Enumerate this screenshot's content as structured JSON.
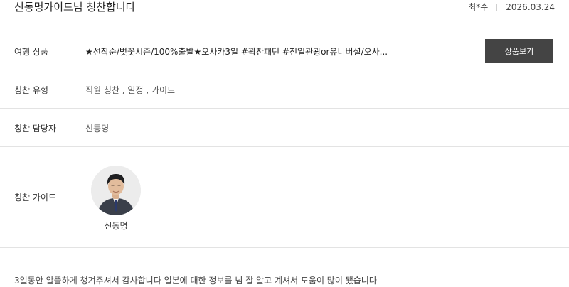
{
  "post": {
    "title": "신동명가이드님 칭찬합니다",
    "author": "최*수",
    "date": "2026.03.24"
  },
  "rows": {
    "product": {
      "label": "여행 상품",
      "value": "★선착순/벚꽃시즌/100%출발★오사카3일 #꽉찬패턴 #전일관광or유니버셜/오사...",
      "button_label": "상품보기"
    },
    "praise_type": {
      "label": "칭찬 유형",
      "value": "직원 칭찬 , 일정 , 가이드"
    },
    "praise_staff": {
      "label": "칭찬 담당자",
      "value": "신동명"
    },
    "praise_guide": {
      "label": "칭찬 가이드",
      "guide_name": "신동명"
    }
  },
  "comment": "3일동안 알뜰하게 챙겨주셔서 감사합니다 일본에 대한 정보를 넘 잘 알고 계셔서 도움이 많이 됐습니다",
  "colors": {
    "button_bg": "#444444",
    "header_rule": "#333333",
    "row_rule": "#e3e3e3"
  }
}
